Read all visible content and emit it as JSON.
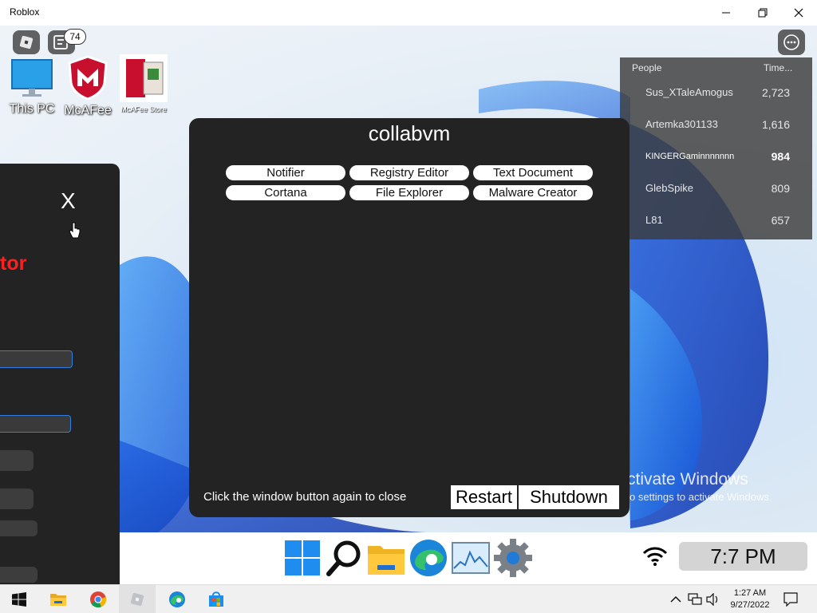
{
  "window": {
    "title": "Roblox"
  },
  "roblox": {
    "notification_count": "74"
  },
  "desktop_icons": [
    {
      "label": "This PC"
    },
    {
      "label": "McAFee"
    },
    {
      "label": "McAFee Store"
    }
  ],
  "left_panel": {
    "close_label": "X",
    "heading_fragment": "tor"
  },
  "leaderboard": {
    "headers": [
      "People",
      "Time..."
    ],
    "rows": [
      {
        "name": "Sus_XTaleAmogus",
        "value": "2,723"
      },
      {
        "name": "Artemka301133",
        "value": "1,616"
      },
      {
        "name": "KINGERGaminnnnnnn",
        "value": "984"
      },
      {
        "name": "GlebSpike",
        "value": "809"
      },
      {
        "name": "L81",
        "value": "657"
      }
    ]
  },
  "dialog": {
    "title": "collabvm",
    "apps": [
      "Notifier",
      "Registry Editor",
      "Text Document",
      "Cortana",
      "File Explorer",
      "Malware Creator"
    ],
    "hint": "Click the window button again to close",
    "restart_label": "Restart",
    "shutdown_label": "Shutdown"
  },
  "watermark": {
    "line1": "ctivate Windows",
    "line2": "o settings to activate Windows"
  },
  "game_taskbar": {
    "icons": [
      "windows-start-icon",
      "search-icon",
      "file-explorer-icon",
      "edge-icon",
      "task-manager-icon",
      "settings-gear-icon"
    ],
    "clock": "7:7 PM"
  },
  "host_taskbar": {
    "icons": [
      "windows-start-icon",
      "file-explorer-icon",
      "chrome-icon",
      "roblox-icon",
      "edge-icon",
      "store-icon"
    ],
    "time": "1:27 AM",
    "date": "9/27/2022"
  },
  "colors": {
    "accent_red": "#ff1f1f",
    "panel_dark": "#232323",
    "field_blue": "#2f7fe0"
  }
}
